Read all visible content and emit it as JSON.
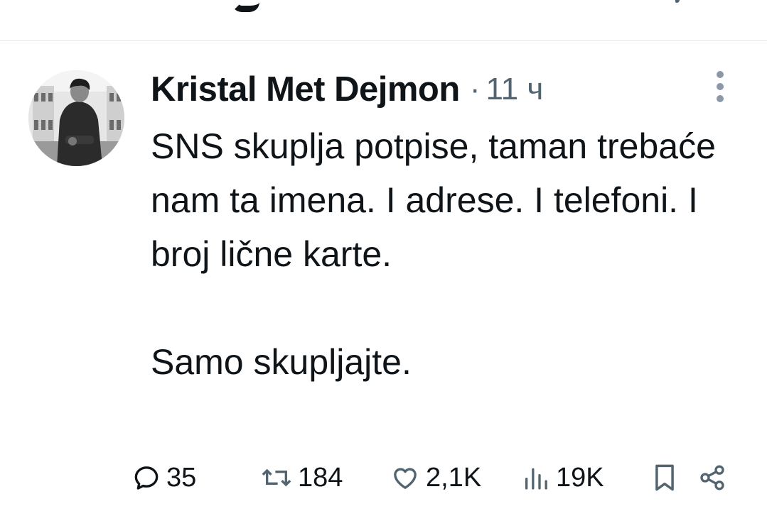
{
  "tweet": {
    "author_name": "Kristal Met Dejmon",
    "separator": "·",
    "timestamp": "11 ч",
    "text": "SNS skuplja potpise, taman trebaće nam ta imena. I adrese. I telefoni. I broj lične karte.\n\nSamo skupljajte.",
    "icons": {
      "more": "more-vertical-icon",
      "reply": "reply-icon",
      "retweet": "retweet-icon",
      "like": "heart-icon",
      "views": "views-icon",
      "bookmark": "bookmark-icon",
      "share": "share-icon"
    },
    "metrics": {
      "replies": "35",
      "retweets": "184",
      "likes": "2,1K",
      "views": "19K"
    }
  },
  "colors": {
    "text_primary": "#0f1419",
    "text_secondary": "#536471",
    "divider": "#e3e6e9",
    "icon_gray": "#8b98a5"
  }
}
